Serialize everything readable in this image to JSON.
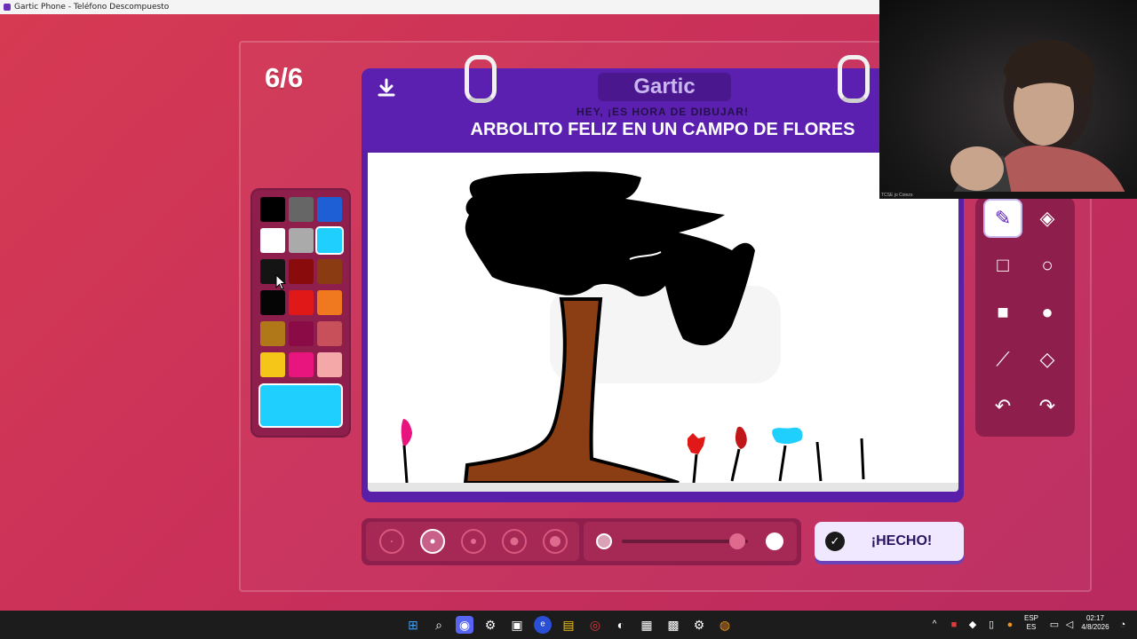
{
  "window": {
    "title": "Gartic Phone - Teléfono Descompuesto"
  },
  "game": {
    "round": "6/6",
    "logo": "Gartic",
    "prompt_label": "HEY, ¡ES HORA DE DIBUJAR!",
    "prompt": "ARBOLITO FELIZ EN UN CAMPO DE FLORES",
    "done_label": "¡HECHO!"
  },
  "palette": {
    "colors": [
      "#000000",
      "#666666",
      "#1f5fd6",
      "#ffffff",
      "#aaaaaa",
      "#1fd0ff",
      "#141414",
      "#8a0b0b",
      "#8a3b12",
      "#050505",
      "#e01818",
      "#f0781e",
      "#b07818",
      "#8a0b45",
      "#c8505a",
      "#f5c518",
      "#e8157f",
      "#f4a8a8"
    ],
    "selected": "#1fd0ff",
    "current_color": "#1fd0ff"
  },
  "tools": [
    {
      "name": "pencil",
      "icon": "pencil-icon",
      "glyph": "✎"
    },
    {
      "name": "eraser",
      "icon": "eraser-icon",
      "glyph": "◈"
    },
    {
      "name": "rect-outline",
      "icon": "square-outline-icon",
      "glyph": "□"
    },
    {
      "name": "ellipse-outline",
      "icon": "circle-outline-icon",
      "glyph": "○"
    },
    {
      "name": "rect-fill",
      "icon": "square-fill-icon",
      "glyph": "■"
    },
    {
      "name": "ellipse-fill",
      "icon": "circle-fill-icon",
      "glyph": "●"
    },
    {
      "name": "line",
      "icon": "line-icon",
      "glyph": "⟋"
    },
    {
      "name": "fill",
      "icon": "paint-bucket-icon",
      "glyph": "◇"
    },
    {
      "name": "undo",
      "icon": "undo-icon",
      "glyph": "↶"
    },
    {
      "name": "redo",
      "icon": "redo-icon",
      "glyph": "↷"
    }
  ],
  "active_tool": "pencil",
  "brush_sizes": {
    "count": 5,
    "selected_index": 1
  },
  "opacity_slider": {
    "value_fraction": 0.85
  },
  "taskbar": {
    "lang": "ESP",
    "lang_sub": "ES",
    "time": "02:17",
    "date": "4/8/2026"
  },
  "webcam": {
    "caption": "TCSE jo Coiezo"
  }
}
